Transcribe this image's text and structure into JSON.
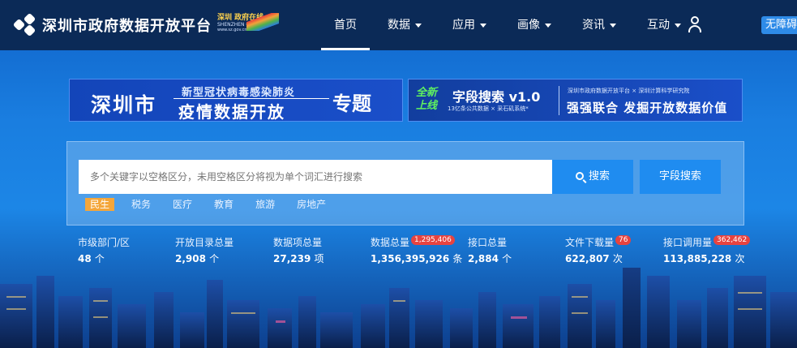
{
  "header": {
    "title": "深圳市政府数据开放平台",
    "badge": {
      "line1": "深圳 政府在线",
      "line2": "SHENZHEN CHINA",
      "line3": "www.sz.gov.cn"
    },
    "nav": [
      {
        "label": "首页",
        "active": true
      },
      {
        "label": "数据",
        "dropdown": true
      },
      {
        "label": "应用",
        "dropdown": true
      },
      {
        "label": "画像",
        "dropdown": true
      },
      {
        "label": "资讯",
        "dropdown": true
      },
      {
        "label": "互动",
        "dropdown": true
      }
    ],
    "accessibility_label": "无障碍"
  },
  "banner_left": {
    "city": "深圳市",
    "top_line": "新型冠状病毒感染肺炎",
    "main_line": "疫情数据开放",
    "tag": "专题"
  },
  "banner_right": {
    "new_line1": "全新",
    "new_line2": "上线",
    "title": "字段搜索 v1.0",
    "subtitle": "13亿条公共数据 × 采石矶系统*",
    "partners": "深圳市政府数据开放平台 × 深圳计算科学研究院",
    "slogan": "强强联合 发掘开放数据价值"
  },
  "search": {
    "placeholder": "多个关键字以空格区分，未用空格区分将视为单个词汇进行搜索",
    "search_label": "搜索",
    "field_search_label": "字段搜索",
    "tags": [
      {
        "label": "民生",
        "active": true
      },
      {
        "label": "税务"
      },
      {
        "label": "医疗"
      },
      {
        "label": "教育"
      },
      {
        "label": "旅游"
      },
      {
        "label": "房地产"
      }
    ]
  },
  "stats": [
    {
      "label": "市级部门/区",
      "value": "48",
      "unit": "个"
    },
    {
      "label": "开放目录总量",
      "value": "2,908",
      "unit": "个"
    },
    {
      "label": "数据项总量",
      "value": "27,239",
      "unit": "项"
    },
    {
      "label": "数据总量",
      "value": "1,356,395,926",
      "unit": "条",
      "badge": "1,295,406"
    },
    {
      "label": "接口总量",
      "value": "2,884",
      "unit": "个"
    },
    {
      "label": "文件下载量",
      "value": "622,807",
      "unit": "次",
      "badge": "76"
    },
    {
      "label": "接口调用量",
      "value": "113,885,228",
      "unit": "次",
      "badge": "362,462"
    }
  ],
  "colors": {
    "nav_bg": "#0b2a57",
    "accent": "#1f8cf0",
    "tag_active": "#f4a63a",
    "badge": "#e8433f"
  }
}
